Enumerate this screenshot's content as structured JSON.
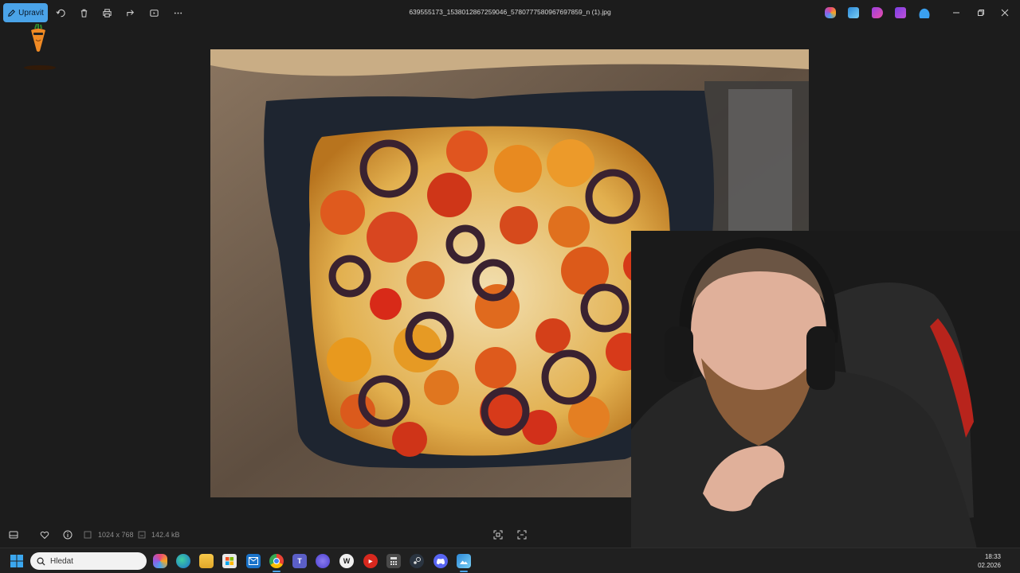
{
  "titlebar": {
    "edit_label": "Upravit",
    "file_name": "639555173_1538012867259046_5780777580967697859_n (1).jpg"
  },
  "bottombar": {
    "dimensions": "1024 x 768",
    "file_size": "142.4 kB"
  },
  "taskbar": {
    "search_placeholder": "Hledat",
    "time": "18:33",
    "date": "02.2026"
  },
  "colors": {
    "accent": "#4aa3e8",
    "background": "#1c1c1c",
    "taskbar": "#202020"
  },
  "icons": {
    "titlebar": [
      "rotate-icon",
      "delete-icon",
      "print-icon",
      "share-icon",
      "slideshow-icon",
      "more-icon"
    ],
    "titlebar_right": [
      "copilot-icon",
      "photos-icon",
      "clipchamp-icon",
      "designer-icon",
      "onedrive-icon"
    ],
    "bottombar": [
      "filmstrip-icon",
      "favorite-icon",
      "info-icon",
      "zoom-fit-icon",
      "actual-size-icon",
      "fullscreen-icon"
    ],
    "taskbar": [
      "start-icon",
      "copilot-icon",
      "edge-icon",
      "file-explorer-icon",
      "store-icon",
      "mail-icon",
      "chrome-icon",
      "teams-icon",
      "app-icon",
      "wordpress-icon",
      "media-icon",
      "calculator-icon",
      "steam-icon",
      "discord-icon",
      "photos-icon"
    ]
  }
}
